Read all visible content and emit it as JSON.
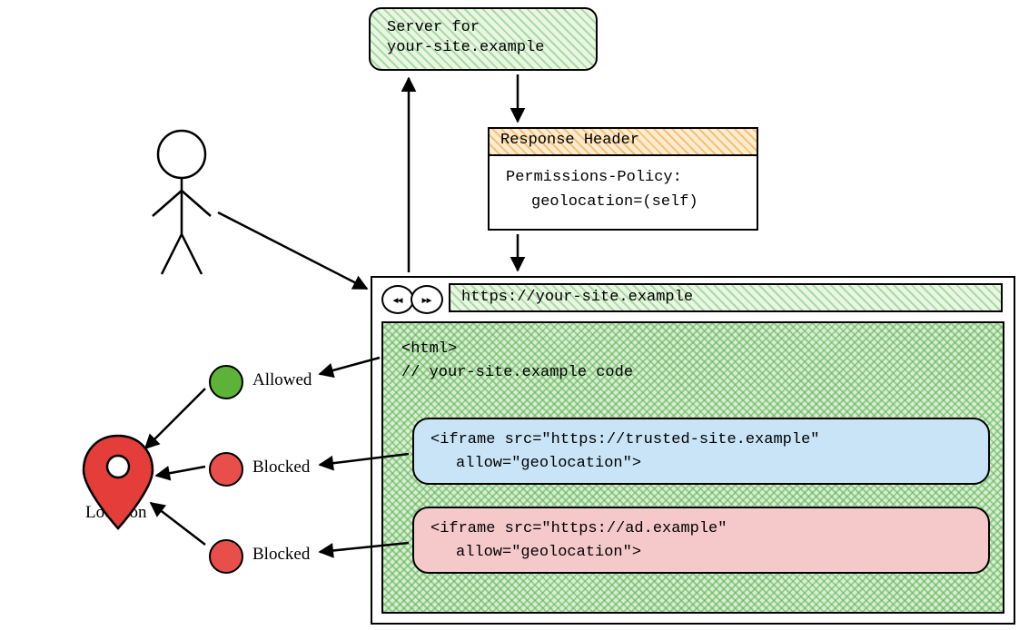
{
  "server": {
    "label_line1": "Server for",
    "label_line2": "your-site.example"
  },
  "response_header": {
    "title": "Response Header",
    "line1": "Permissions-Policy:",
    "line2_indented": "geolocation=(self)"
  },
  "browser": {
    "back_glyph": "◂◂",
    "fwd_glyph": "▸▸",
    "url": "https://your-site.example",
    "code_line1": "<html>",
    "code_line2": "// your-site.example code",
    "iframe_trusted_line1": "<iframe src=\"https://trusted-site.example\"",
    "iframe_trusted_line2": "allow=\"geolocation\">",
    "iframe_ad_line1": "<iframe src=\"https://ad.example\"",
    "iframe_ad_line2": "allow=\"geolocation\">"
  },
  "statuses": {
    "allowed": "Allowed",
    "blocked": "Blocked"
  },
  "location_label": "Location",
  "colors": {
    "green_hatch": "#7bc46c",
    "orange_hatch": "#f3b65f",
    "blue_fill": "#c8e4f6",
    "pink_fill": "#f5c9ca",
    "dot_green": "#5cb338",
    "dot_red": "#e94f4a",
    "pin_red": "#e43d3a"
  }
}
